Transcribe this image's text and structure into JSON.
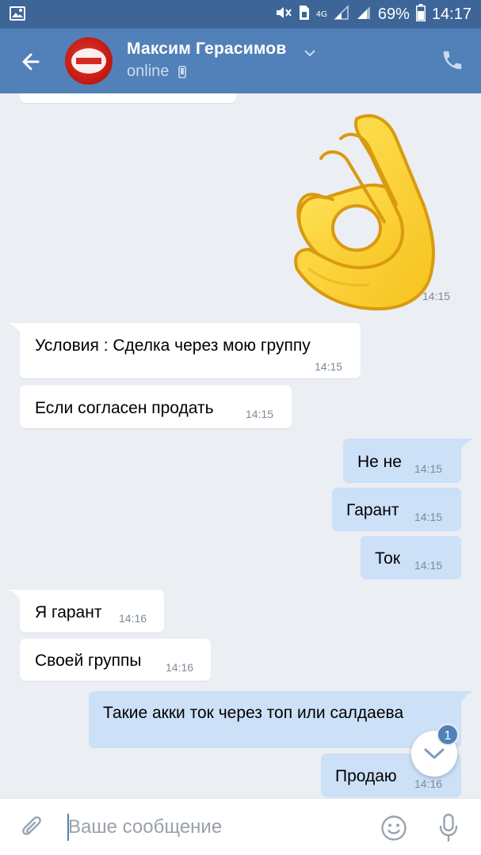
{
  "status_bar": {
    "network": "4G",
    "battery": "69%",
    "time": "14:17"
  },
  "header": {
    "contact_name": "Максим Герасимов",
    "status": "online",
    "icons": [
      "back-arrow-icon",
      "chevron-down-icon",
      "mobile-phone-icon",
      "phone-call-icon"
    ]
  },
  "messages": [
    {
      "type": "sticker",
      "dir": "out",
      "sticker": "ok-hand-emoji",
      "time": "14:15"
    },
    {
      "dir": "in",
      "text": "Условия : Сделка через мою группу",
      "time": "14:15"
    },
    {
      "dir": "in",
      "text": "Если согласен продать",
      "time": "14:15"
    },
    {
      "dir": "out",
      "text": "Не не",
      "time": "14:15"
    },
    {
      "dir": "out",
      "text": "Гарант",
      "time": "14:15"
    },
    {
      "dir": "out",
      "text": "Ток",
      "time": "14:15"
    },
    {
      "dir": "in",
      "text": "Я гарант",
      "time": "14:16"
    },
    {
      "dir": "in",
      "text": "Своей группы",
      "time": "14:16"
    },
    {
      "dir": "out",
      "text": "Такие акки ток через топ или салдаева",
      "time": ""
    },
    {
      "dir": "out",
      "text": "Продаю",
      "time": "14:16"
    }
  ],
  "scroll_fab": {
    "badge": "1"
  },
  "composer": {
    "placeholder": "Ваше сообщение"
  },
  "colors": {
    "header": "#5181b8",
    "status_bar": "#3e6597",
    "incoming_bubble": "#ffffff",
    "outgoing_bubble": "#cce0f7",
    "background": "#ebeef3"
  }
}
